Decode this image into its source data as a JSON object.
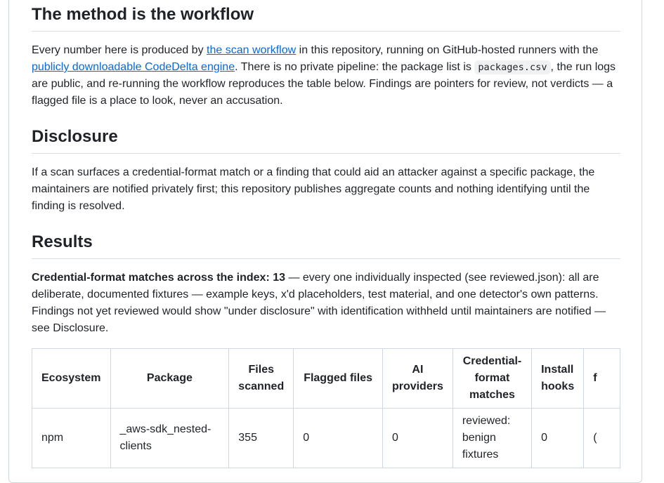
{
  "method": {
    "heading": "The method is the workflow",
    "text1": "Every number here is produced by ",
    "link1": "the scan workflow",
    "text2": " in this repository, running on GitHub-hosted runners with the ",
    "link2": "publicly downloadable CodeDelta engine",
    "text3": ". There is no private pipeline: the package list is ",
    "code": "packages.csv",
    "text4": ", the run logs are public, and re-running the workflow reproduces the table below. Findings are pointers for review, not verdicts — a flagged file is a place to look, never an accusation."
  },
  "disclosure": {
    "heading": "Disclosure",
    "text": "If a scan surfaces a credential-format match or a finding that could aid an attacker against a specific package, the maintainers are notified privately first; this repository publishes aggregate counts and nothing identifying until the finding is resolved."
  },
  "results": {
    "heading": "Results",
    "bold": "Credential-format matches across the index: 13",
    "text": " — every one individually inspected (see reviewed.json): all are deliberate, documented fixtures — example keys, x'd placeholders, test material, and one detector's own patterns. Findings not yet reviewed would show \"under disclosure\" with identification withheld until maintainers are notified — see Disclosure."
  },
  "table": {
    "headers": [
      "Ecosystem",
      "Package",
      "Files scanned",
      "Flagged files",
      "AI providers",
      "Credential-format matches",
      "Install hooks",
      "f"
    ],
    "rows": [
      [
        "npm",
        "_aws-sdk_nested-clients",
        "355",
        "0",
        "0",
        "reviewed: benign fixtures",
        "0",
        "("
      ]
    ]
  }
}
